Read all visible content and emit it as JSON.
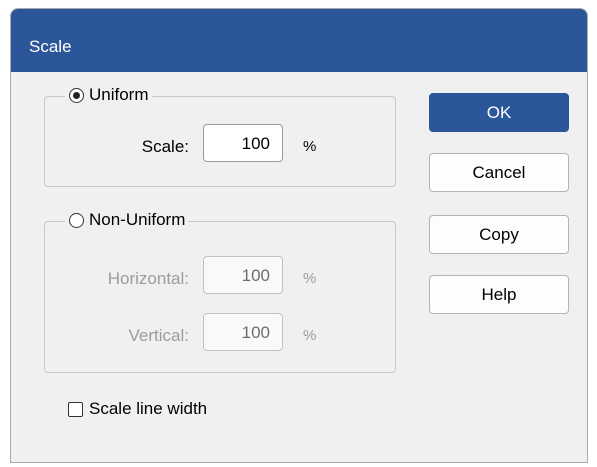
{
  "dialog": {
    "title": "Scale"
  },
  "uniform": {
    "label": "Uniform",
    "selected": true,
    "scale_label": "Scale:",
    "scale_value": "100",
    "scale_unit": "%"
  },
  "non_uniform": {
    "label": "Non-Uniform",
    "selected": false,
    "horizontal_label": "Horizontal:",
    "horizontal_value": "100",
    "horizontal_unit": "%",
    "vertical_label": "Vertical:",
    "vertical_value": "100",
    "vertical_unit": "%"
  },
  "scale_line_width": {
    "label": "Scale line width",
    "checked": false
  },
  "buttons": {
    "ok": "OK",
    "cancel": "Cancel",
    "copy": "Copy",
    "help": "Help"
  },
  "colors": {
    "title_bar": "#2b579a",
    "primary_button": "#2b579a",
    "dialog_background": "#f0f0f0"
  }
}
